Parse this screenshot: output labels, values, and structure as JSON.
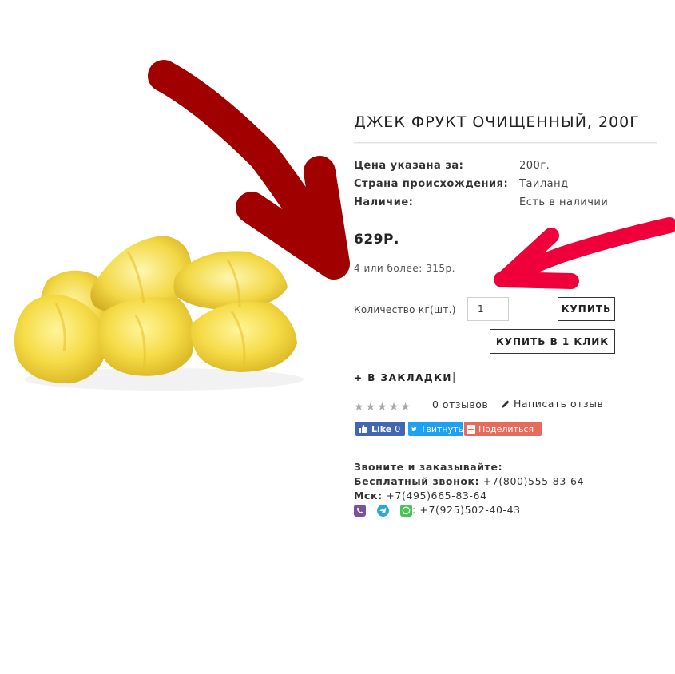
{
  "product": {
    "title": "ДЖЕК ФРУКТ ОЧИЩЕННЫЙ, 200Г",
    "specs": [
      {
        "label": "Цена указана за:",
        "value": "200г."
      },
      {
        "label": "Страна происхождения:",
        "value": "Таиланд"
      },
      {
        "label": "Наличие:",
        "value": "Есть в наличии"
      }
    ],
    "price": "629Р.",
    "bulk_price": "4 или более: 315р."
  },
  "purchase": {
    "quantity_label": "Количество кг(шт.)",
    "quantity_value": "1",
    "buy_label": "КУПИТЬ",
    "buy_one_click_label": "КУПИТЬ В 1 КЛИК",
    "bookmark_label": "+ В ЗАКЛАДКИ",
    "bookmark_separator": "|"
  },
  "reviews": {
    "rating": 0,
    "max_stars": 5,
    "count_text": "0 отзывов",
    "write_label": "Написать отзыв"
  },
  "social": {
    "like_label": "Like",
    "like_count": "0",
    "tweet_label": "Твитнуть",
    "share_label": "Поделиться"
  },
  "contacts": {
    "heading": "Звоните и заказывайте:",
    "free_label": "Бесплатный звонок:",
    "free_phone": "+7(800)555-83-64",
    "msk_label": "Мск:",
    "msk_phone": "+7(495)665-83-64",
    "messenger_phone": ": +7(925)502-40-43"
  },
  "icons": [
    "pencil-icon",
    "facebook-like-icon",
    "twitter-icon",
    "plus-icon",
    "viber-icon",
    "telegram-icon",
    "whatsapp-icon",
    "star-icon"
  ],
  "colors": {
    "arrow": "#a00000",
    "arrow2": "#f0003a",
    "facebook": "#4267b2",
    "twitter": "#1da1f2",
    "share": "#e86a5a"
  }
}
